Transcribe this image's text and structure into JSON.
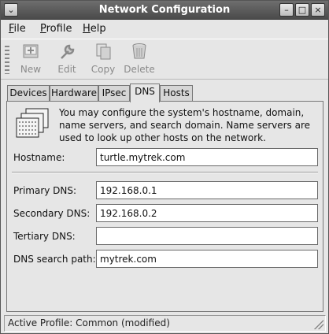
{
  "window": {
    "title": "Network Configuration"
  },
  "menubar": {
    "items": [
      {
        "mnemonic": "F",
        "rest": "ile"
      },
      {
        "mnemonic": "P",
        "rest": "rofile"
      },
      {
        "mnemonic": "H",
        "rest": "elp"
      }
    ]
  },
  "toolbar": {
    "buttons": [
      {
        "label": "New",
        "icon": "new-device-icon",
        "enabled": false
      },
      {
        "label": "Edit",
        "icon": "wrench-icon",
        "enabled": false
      },
      {
        "label": "Copy",
        "icon": "copy-icon",
        "enabled": false
      },
      {
        "label": "Delete",
        "icon": "trash-icon",
        "enabled": false
      }
    ]
  },
  "tabs": [
    {
      "label": "Devices",
      "active": false
    },
    {
      "label": "Hardware",
      "active": false
    },
    {
      "label": "IPsec",
      "active": false
    },
    {
      "label": "DNS",
      "active": true
    },
    {
      "label": "Hosts",
      "active": false
    }
  ],
  "dns": {
    "description": "You may configure the system's hostname, domain, name servers, and search domain. Name servers are used to look up other hosts on the network.",
    "hostname": {
      "label": "Hostname:",
      "value": "turtle.mytrek.com"
    },
    "primary": {
      "label": "Primary DNS:",
      "value": "192.168.0.1"
    },
    "secondary": {
      "label": "Secondary DNS:",
      "value": "192.168.0.2"
    },
    "tertiary": {
      "label": "Tertiary DNS:",
      "value": ""
    },
    "search": {
      "label": "DNS search path:",
      "value": "mytrek.com"
    }
  },
  "status": {
    "text": "Active Profile: Common (modified)"
  }
}
